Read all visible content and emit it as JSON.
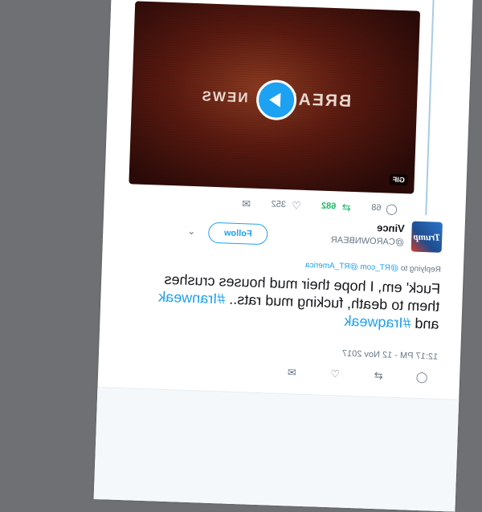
{
  "quoted_media": {
    "title_left": "BREAK",
    "title_right": "NEWS",
    "play_icon": "play-icon",
    "gif_label": "GIF"
  },
  "quoted_actions": {
    "reply_count": "68",
    "retweet_count": "682",
    "like_count": "352"
  },
  "tweet": {
    "author_name": "Vince",
    "author_handle": "@CAROWNBEAR",
    "avatar_text": "Trump",
    "follow_label": "Follow",
    "replying_prefix": "Replying to",
    "replying_mentions": "@RT_com @RT_America",
    "text_line1": "Fuck' em, I hope their mud houses crushes",
    "text_line2": "them to death, fucking mud rats..",
    "hashtag1": "#Iranweak",
    "text_and": "and",
    "hashtag2": "#Iraqweak",
    "timestamp": "12:17 PM - 12 Nov 2017"
  },
  "colors": {
    "accent": "#1da1f2",
    "retweet": "#17bf63",
    "muted": "#657786"
  }
}
